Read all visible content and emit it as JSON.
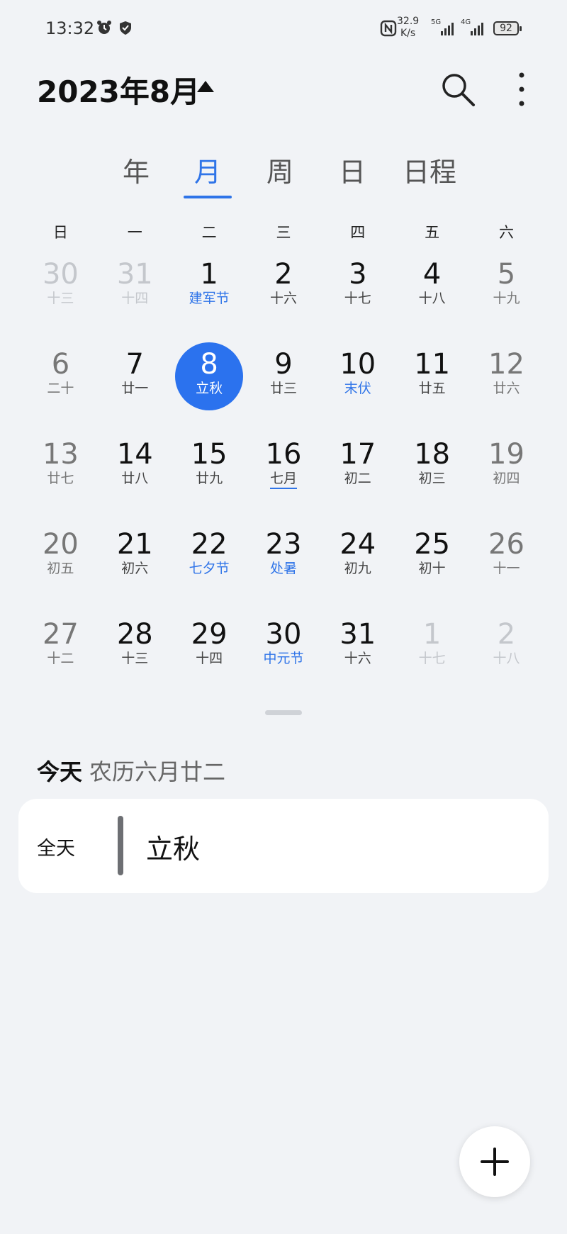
{
  "status_bar": {
    "time": "13:32",
    "speed_value": "32.9",
    "speed_unit": "K/s",
    "network1": "5G",
    "network2": "4G",
    "battery": "92"
  },
  "header": {
    "month_title": "2023年8月"
  },
  "tabs": [
    {
      "label": "年",
      "active": false
    },
    {
      "label": "月",
      "active": true
    },
    {
      "label": "周",
      "active": false
    },
    {
      "label": "日",
      "active": false
    },
    {
      "label": "日程",
      "active": false
    }
  ],
  "weekdays": [
    "日",
    "一",
    "二",
    "三",
    "四",
    "五",
    "六"
  ],
  "weeks": [
    [
      {
        "day": "30",
        "lunar": "十三",
        "type": "other"
      },
      {
        "day": "31",
        "lunar": "十四",
        "type": "other"
      },
      {
        "day": "1",
        "lunar": "建军节",
        "type": "festival"
      },
      {
        "day": "2",
        "lunar": "十六",
        "type": ""
      },
      {
        "day": "3",
        "lunar": "十七",
        "type": ""
      },
      {
        "day": "4",
        "lunar": "十八",
        "type": ""
      },
      {
        "day": "5",
        "lunar": "十九",
        "type": "weekend"
      }
    ],
    [
      {
        "day": "6",
        "lunar": "二十",
        "type": "weekend"
      },
      {
        "day": "7",
        "lunar": "廿一",
        "type": ""
      },
      {
        "day": "8",
        "lunar": "立秋",
        "type": "today"
      },
      {
        "day": "9",
        "lunar": "廿三",
        "type": ""
      },
      {
        "day": "10",
        "lunar": "末伏",
        "type": "festival"
      },
      {
        "day": "11",
        "lunar": "廿五",
        "type": ""
      },
      {
        "day": "12",
        "lunar": "廿六",
        "type": "weekend"
      }
    ],
    [
      {
        "day": "13",
        "lunar": "廿七",
        "type": "weekend"
      },
      {
        "day": "14",
        "lunar": "廿八",
        "type": ""
      },
      {
        "day": "15",
        "lunar": "廿九",
        "type": ""
      },
      {
        "day": "16",
        "lunar": "七月",
        "type": "month-start"
      },
      {
        "day": "17",
        "lunar": "初二",
        "type": ""
      },
      {
        "day": "18",
        "lunar": "初三",
        "type": ""
      },
      {
        "day": "19",
        "lunar": "初四",
        "type": "weekend"
      }
    ],
    [
      {
        "day": "20",
        "lunar": "初五",
        "type": "weekend"
      },
      {
        "day": "21",
        "lunar": "初六",
        "type": ""
      },
      {
        "day": "22",
        "lunar": "七夕节",
        "type": "festival"
      },
      {
        "day": "23",
        "lunar": "处暑",
        "type": "festival"
      },
      {
        "day": "24",
        "lunar": "初九",
        "type": ""
      },
      {
        "day": "25",
        "lunar": "初十",
        "type": ""
      },
      {
        "day": "26",
        "lunar": "十一",
        "type": "weekend"
      }
    ],
    [
      {
        "day": "27",
        "lunar": "十二",
        "type": "weekend"
      },
      {
        "day": "28",
        "lunar": "十三",
        "type": ""
      },
      {
        "day": "29",
        "lunar": "十四",
        "type": ""
      },
      {
        "day": "30",
        "lunar": "中元节",
        "type": "festival"
      },
      {
        "day": "31",
        "lunar": "十六",
        "type": ""
      },
      {
        "day": "1",
        "lunar": "十七",
        "type": "other"
      },
      {
        "day": "2",
        "lunar": "十八",
        "type": "other"
      }
    ]
  ],
  "today": {
    "label": "今天",
    "lunar_date": "农历六月廿二"
  },
  "event": {
    "time": "全天",
    "title": "立秋"
  },
  "colors": {
    "accent": "#2f74e8",
    "today_circle": "#2b72ee",
    "background": "#f1f3f6"
  },
  "icons": {
    "search": "search-icon",
    "more": "more-vertical-icon",
    "add": "plus-icon",
    "alarm": "alarm-icon",
    "shield": "heart-shield-icon",
    "nfc": "nfc-icon"
  }
}
